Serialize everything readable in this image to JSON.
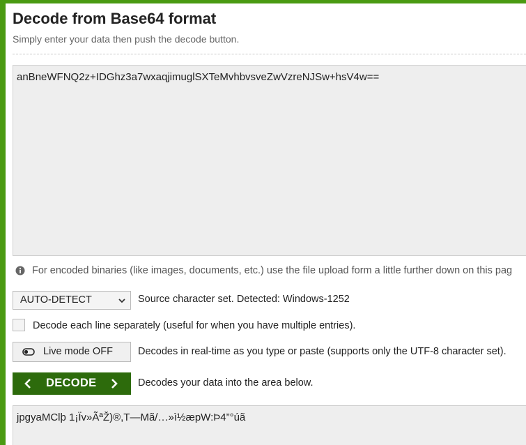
{
  "page": {
    "title": "Decode from Base64 format",
    "subtitle": "Simply enter your data then push the decode button."
  },
  "input": {
    "value": "anBneWFNQ2z+IDGhz3a7wxaqjimuglSXTeMvhbvsveZwVzreNJSw+hsV4w=="
  },
  "info": {
    "icon": "info-icon",
    "text": "For encoded binaries (like images, documents, etc.) use the file upload form a little further down on this pag"
  },
  "charset": {
    "selected": "AUTO-DETECT",
    "icon": "chevron-down-icon",
    "description": "Source character set. Detected: Windows-1252"
  },
  "each_line": {
    "checked": false,
    "label": "Decode each line separately (useful for when you have multiple entries)."
  },
  "live_mode": {
    "label": "Live mode OFF",
    "icon": "toggle-off-icon",
    "description": "Decodes in real-time as you type or paste (supports only the UTF-8 character set)."
  },
  "decode": {
    "label": "DECODE",
    "description": "Decodes your data into the area below."
  },
  "output": {
    "value": "jpgyaMClþ 1¡Ïv»ÃªŽ)®,T—Mã/…»ì½æpW:Þ4”°úã"
  },
  "colors": {
    "brand_green": "#4a9a12",
    "button_green": "#2d6b0c",
    "textarea_bg": "#eeeeee"
  }
}
